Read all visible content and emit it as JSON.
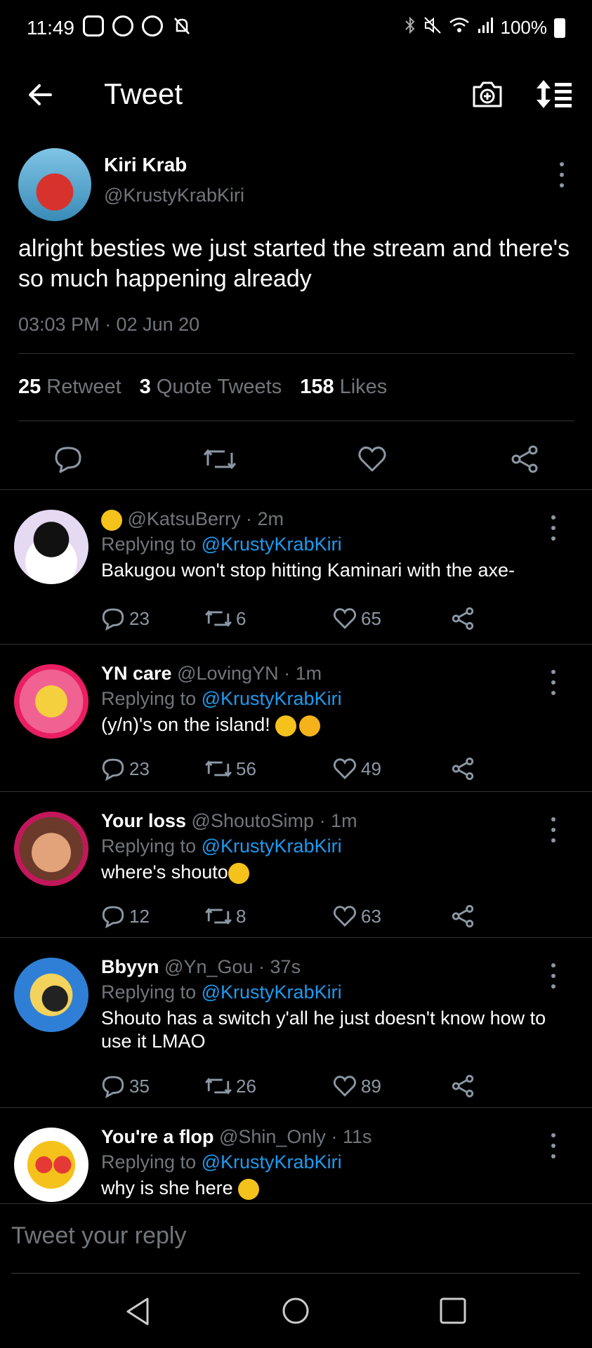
{
  "status_bar": {
    "time": "11:49",
    "battery": "100%"
  },
  "app_bar": {
    "title": "Tweet"
  },
  "main_tweet": {
    "name": "Kiri Krab",
    "handle": "@KrustyKrabKiri",
    "text": "alright besties we just started the stream and there's so much happening already",
    "timestamp": "03:03 PM · 02 Jun 20",
    "retweets_count": "25",
    "retweets_label": "Retweet",
    "quotes_count": "3",
    "quotes_label": "Quote Tweets",
    "likes_count": "158",
    "likes_label": "Likes"
  },
  "replies": [
    {
      "name": "",
      "handle": "@KatsuBerry",
      "time": "· 2m",
      "replying_prefix": "Replying to",
      "replying_handle": "@KrustyKrabKiri",
      "text": "Bakugou won't stop hitting Kaminari with the axe-",
      "reply_count": "23",
      "retweet_count": "6",
      "like_count": "65"
    },
    {
      "name": "YN care",
      "handle": "@LovingYN",
      "time": "· 1m",
      "replying_prefix": "Replying to",
      "replying_handle": "@KrustyKrabKiri",
      "text": "(y/n)'s on the island!",
      "reply_count": "23",
      "retweet_count": "56",
      "like_count": "49"
    },
    {
      "name": "Your loss",
      "handle": "@ShoutoSimp",
      "time": "· 1m",
      "replying_prefix": "Replying to",
      "replying_handle": "@KrustyKrabKiri",
      "text": "where's shouto",
      "reply_count": "12",
      "retweet_count": "8",
      "like_count": "63"
    },
    {
      "name": "Bbyyn",
      "handle": "@Yn_Gou",
      "time": "· 37s",
      "replying_prefix": "Replying to",
      "replying_handle": "@KrustyKrabKiri",
      "text": "Shouto has a switch y'all he just doesn't know how to use it LMAO",
      "reply_count": "35",
      "retweet_count": "26",
      "like_count": "89"
    },
    {
      "name": "You're a flop",
      "handle": "@Shin_Only",
      "time": "· 11s",
      "replying_prefix": "Replying to",
      "replying_handle": "@KrustyKrabKiri",
      "text": "why is she here"
    }
  ],
  "composer": {
    "placeholder": "Tweet your reply"
  },
  "icons": {
    "back": "arrow-left-icon",
    "camera": "camera-plus-icon",
    "sort": "sort-icon",
    "reply": "reply-icon",
    "retweet": "retweet-icon",
    "like": "heart-icon",
    "share": "share-icon",
    "more": "more-vertical-icon"
  },
  "colors": {
    "background": "#000000",
    "link": "#1d9bf0",
    "muted": "#71767b",
    "text": "#e7e9ea"
  }
}
